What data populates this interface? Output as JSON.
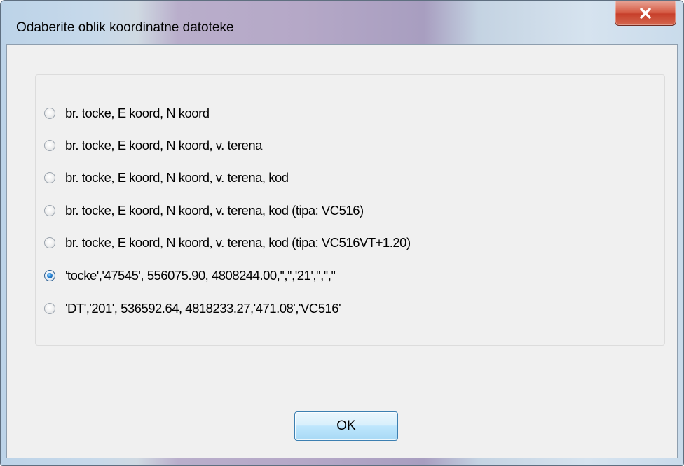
{
  "window": {
    "title": "Odaberite oblik koordinatne datoteke"
  },
  "options": [
    {
      "label": "br. tocke, E koord, N koord",
      "checked": false
    },
    {
      "label": "br. tocke, E koord, N koord, v. terena",
      "checked": false
    },
    {
      "label": "br. tocke, E koord, N koord, v. terena, kod",
      "checked": false
    },
    {
      "label": "br. tocke, E koord, N koord, v. terena, kod (tipa: VC516)",
      "checked": false
    },
    {
      "label": "br. tocke, E koord, N koord, v. terena, kod (tipa: VC516VT+1.20)",
      "checked": false
    },
    {
      "label": "'tocke','47545', 556075.90, 4808244.00,'','','21','','',''",
      "checked": true
    },
    {
      "label": "'DT','201', 536592.64, 4818233.27,'471.08','VC516'",
      "checked": false
    }
  ],
  "buttons": {
    "ok_label": "OK"
  },
  "icons": {
    "close": "close-x-icon"
  },
  "colors": {
    "close_button": "#c7402b",
    "selected_radio": "#2a86d6"
  }
}
